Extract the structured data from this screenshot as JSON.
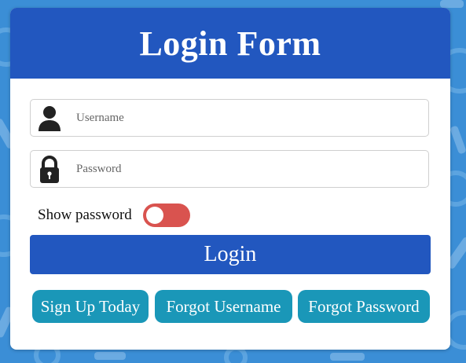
{
  "colors": {
    "background": "#3b8ed6",
    "header": "#2257bf",
    "login_button": "#2257bf",
    "link_buttons": "#1a97b8",
    "toggle_off": "#d9534f"
  },
  "form": {
    "title": "Login Form",
    "username": {
      "icon": "user-icon",
      "placeholder": "Username",
      "value": ""
    },
    "password": {
      "icon": "lock-icon",
      "placeholder": "Password",
      "value": ""
    },
    "show_password": {
      "label": "Show password",
      "checked": false
    },
    "login_label": "Login",
    "links": {
      "sign_up": "Sign Up Today",
      "forgot_username": "Forgot Username",
      "forgot_password": "Forgot Password"
    }
  }
}
